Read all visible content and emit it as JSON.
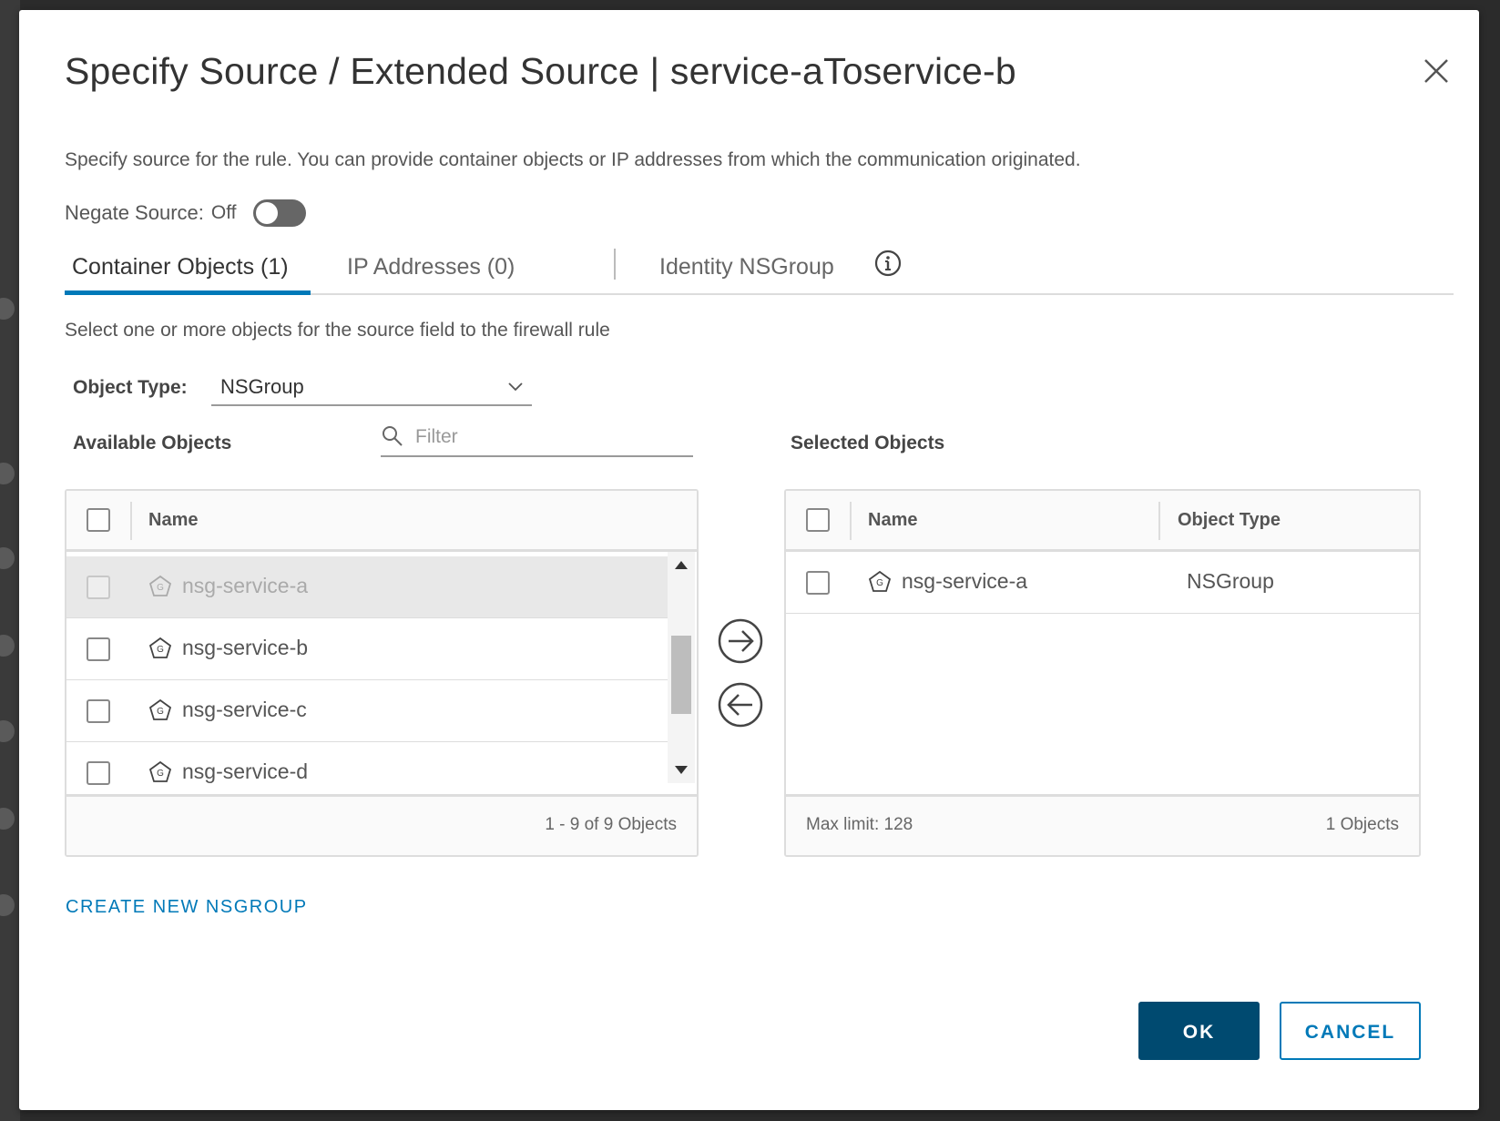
{
  "dialog": {
    "title": "Specify Source / Extended Source | service-aToservice-b",
    "description": "Specify source for the rule. You can provide container objects or IP addresses from which the communication originated.",
    "negate_label": "Negate Source:",
    "negate_state": "Off"
  },
  "tabs": [
    {
      "label": "Container Objects (1)"
    },
    {
      "label": "IP Addresses (0)"
    },
    {
      "label": "Identity NSGroup"
    }
  ],
  "container": {
    "instruction": "Select one or more objects for the source field to the firewall rule",
    "object_type_label": "Object Type:",
    "object_type_value": "NSGroup",
    "available_label": "Available Objects",
    "filter_placeholder": "Filter",
    "selected_label": "Selected Objects"
  },
  "available": {
    "name_header": "Name",
    "rows": [
      {
        "name": "nsg-service-a",
        "disabled": true
      },
      {
        "name": "nsg-service-b",
        "disabled": false
      },
      {
        "name": "nsg-service-c",
        "disabled": false
      },
      {
        "name": "nsg-service-d",
        "disabled": false
      }
    ],
    "footer": "1 - 9 of 9 Objects"
  },
  "selected": {
    "name_header": "Name",
    "type_header": "Object Type",
    "rows": [
      {
        "name": "nsg-service-a",
        "type": "NSGroup"
      }
    ],
    "max_limit": "Max limit: 128",
    "count": "1 Objects"
  },
  "actions": {
    "create_link": "CREATE NEW NSGROUP",
    "ok": "OK",
    "cancel": "CANCEL"
  },
  "colors": {
    "accent": "#0079b8",
    "primary_button": "#004a70"
  }
}
